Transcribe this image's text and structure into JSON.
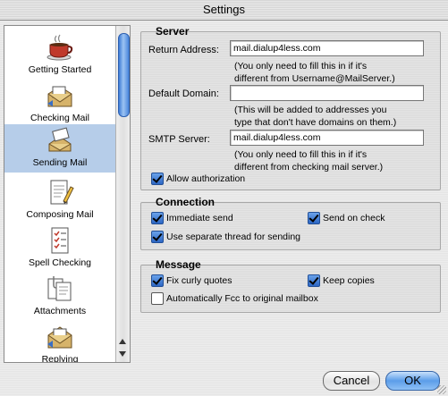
{
  "window": {
    "title": "Settings"
  },
  "sidebar": {
    "items": [
      {
        "label": "Getting Started",
        "icon": "coffee-cup-icon",
        "selected": false
      },
      {
        "label": "Checking Mail",
        "icon": "mailbox-icon",
        "selected": false
      },
      {
        "label": "Sending Mail",
        "icon": "sending-mail-icon",
        "selected": true
      },
      {
        "label": "Composing Mail",
        "icon": "compose-pencil-icon",
        "selected": false
      },
      {
        "label": "Spell Checking",
        "icon": "spell-check-list-icon",
        "selected": false
      },
      {
        "label": "Attachments",
        "icon": "attachments-icon",
        "selected": false
      },
      {
        "label": "Replying",
        "icon": "reply-envelope-icon",
        "selected": false
      }
    ]
  },
  "server": {
    "title": "Server",
    "return_address": {
      "label": "Return Address:",
      "value": "mail.dialup4less.com",
      "hint1": "(You only need to fill this in if it's",
      "hint2": "different from Username@MailServer.)"
    },
    "default_domain": {
      "label": "Default Domain:",
      "value": "",
      "hint1": "(This will be added to addresses you",
      "hint2": "type that don't have domains on them.)"
    },
    "smtp_server": {
      "label": "SMTP Server:",
      "value": "mail.dialup4less.com",
      "hint1": "(You only need to fill this in if it's",
      "hint2": "different from checking mail server.)"
    },
    "allow_authorization": {
      "label": "Allow authorization",
      "checked": true
    }
  },
  "connection": {
    "title": "Connection",
    "immediate_send": {
      "label": "Immediate send",
      "checked": true
    },
    "send_on_check": {
      "label": "Send on check",
      "checked": true
    },
    "separate_thread": {
      "label": "Use separate thread for sending",
      "checked": true
    }
  },
  "message": {
    "title": "Message",
    "fix_curly_quotes": {
      "label": "Fix curly quotes",
      "checked": true
    },
    "keep_copies": {
      "label": "Keep copies",
      "checked": true
    },
    "auto_fcc": {
      "label": "Automatically Fcc to original mailbox",
      "checked": false
    }
  },
  "buttons": {
    "cancel": "Cancel",
    "ok": "OK"
  },
  "colors": {
    "selection": "#b6cde9",
    "accent": "#3d7bd6"
  }
}
